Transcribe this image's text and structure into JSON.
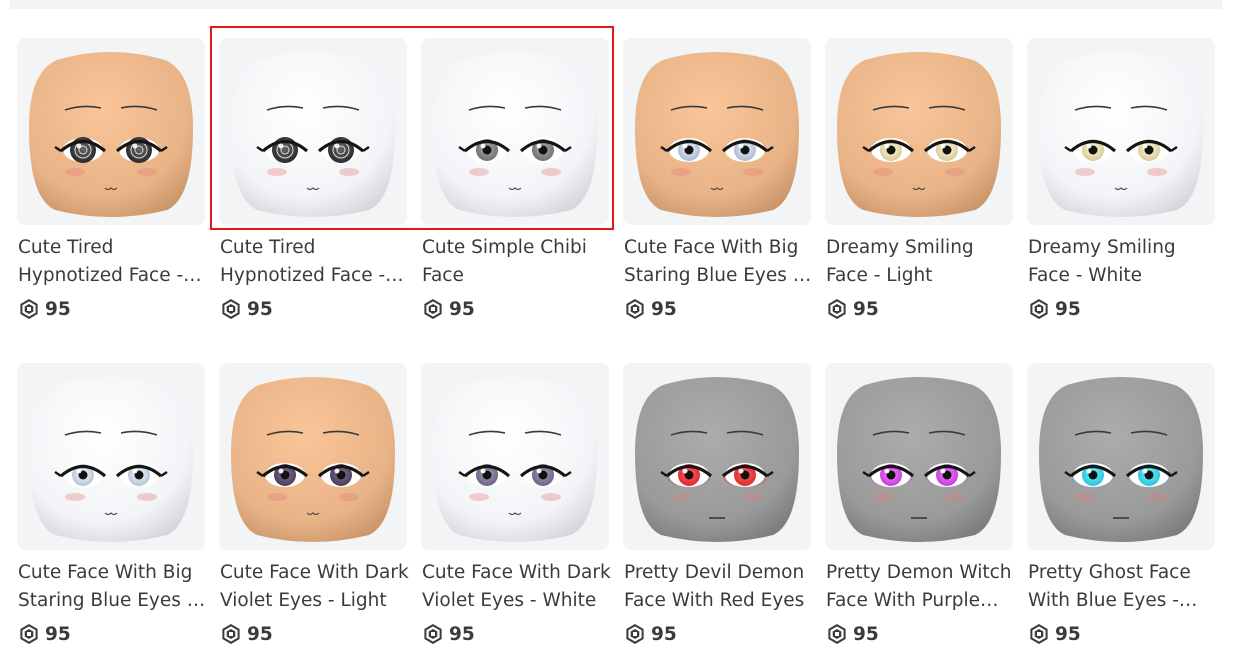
{
  "items": [
    {
      "name": "Cute Tired Hypnotized Face - Light",
      "price": "95",
      "skin": "#e8b386",
      "iris": "#2a2a2a",
      "style": "hypno"
    },
    {
      "name": "Cute Tired Hypnotized Face - White",
      "price": "95",
      "skin": "#f2f4f7",
      "iris": "#2a2a2a",
      "style": "hypno"
    },
    {
      "name": "Cute Simple Chibi Face",
      "price": "95",
      "skin": "#f2f4f7",
      "iris": "#707070",
      "style": "chibi"
    },
    {
      "name": "Cute Face With Big Staring Blue Eyes - Light",
      "price": "95",
      "skin": "#e8b386",
      "iris": "#aeb8cf",
      "style": "stare"
    },
    {
      "name": "Dreamy Smiling Face - Light",
      "price": "95",
      "skin": "#e8b386",
      "iris": "#d9c79a",
      "style": "dreamy"
    },
    {
      "name": "Dreamy Smiling Face - White",
      "price": "95",
      "skin": "#f2f4f7",
      "iris": "#d9c79a",
      "style": "dreamy"
    },
    {
      "name": "Cute Face With Big Staring Blue Eyes - White",
      "price": "95",
      "skin": "#f2f4f7",
      "iris": "#b7c1d6",
      "style": "stare"
    },
    {
      "name": "Cute Face With Dark Violet Eyes - Light",
      "price": "95",
      "skin": "#e8b386",
      "iris": "#4a3a5a",
      "style": "violet"
    },
    {
      "name": "Cute Face With Dark Violet Eyes - White",
      "price": "95",
      "skin": "#f2f4f7",
      "iris": "#6a6480",
      "style": "violet"
    },
    {
      "name": "Pretty Devil Demon Face With Red Eyes",
      "price": "95",
      "skin": "#9a9a9a",
      "iris": "#e0282c",
      "style": "glow"
    },
    {
      "name": "Pretty Demon Witch Face With Purple Eyes",
      "price": "95",
      "skin": "#9a9a9a",
      "iris": "#c040d8",
      "style": "glow"
    },
    {
      "name": "Pretty Ghost Face With Blue Eyes - Gray",
      "price": "95",
      "skin": "#9a9a9a",
      "iris": "#2ec0d8",
      "style": "glow"
    }
  ]
}
